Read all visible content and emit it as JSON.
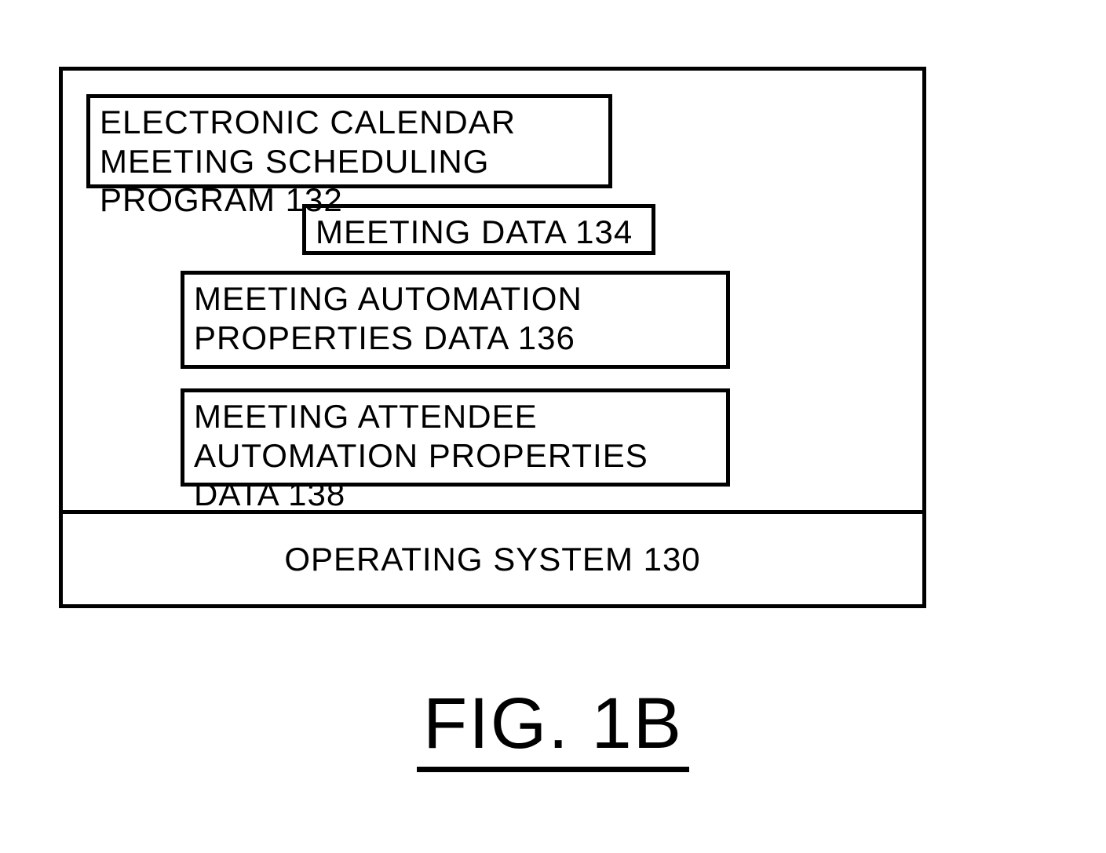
{
  "figure": {
    "label": "FIG. 1B",
    "boxes": {
      "program_132": "ELECTRONIC CALENDAR MEETING SCHEDULING PROGRAM 132",
      "data_134": "MEETING DATA 134",
      "data_136": "MEETING AUTOMATION PROPERTIES DATA 136",
      "data_138": "MEETING ATTENDEE  AUTOMATION PROPERTIES DATA 138",
      "os_130": "OPERATING SYSTEM 130"
    }
  }
}
